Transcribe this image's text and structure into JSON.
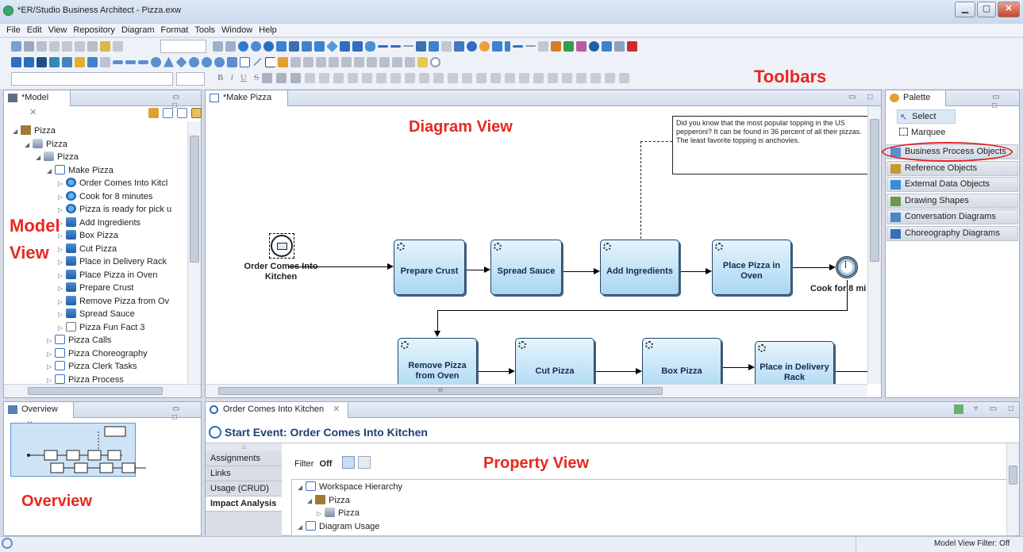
{
  "window": {
    "title": "*ER/Studio Business Architect - Pizza.exw",
    "buttons": {
      "minimize": "▁",
      "maximize": "▢",
      "close": "✕"
    }
  },
  "menu": [
    "File",
    "Edit",
    "View",
    "Repository",
    "Diagram",
    "Format",
    "Tools",
    "Window",
    "Help"
  ],
  "callouts": {
    "toolbars": "Toolbars",
    "diagram_view": "Diagram View",
    "model_view_1": "Model",
    "model_view_2": "View",
    "overview": "Overview",
    "property_view": "Property View"
  },
  "format_toolbar": {
    "bold": "B",
    "italic": "I",
    "underline": "U",
    "strike": "S"
  },
  "model_panel": {
    "tab": "*Model",
    "tree": [
      {
        "label": "Pizza",
        "icon": "folder-icon",
        "expanded": true
      },
      {
        "label": "Pizza",
        "icon": "model-icon",
        "expanded": true
      },
      {
        "label": "Pizza",
        "icon": "model-icon",
        "expanded": true
      },
      {
        "label": "Make Pizza",
        "icon": "process-icon",
        "expanded": true
      },
      {
        "label": "Order Comes Into Kitcl",
        "icon": "start-event-icon",
        "expanded": false
      },
      {
        "label": "Cook for 8 minutes",
        "icon": "event-icon",
        "expanded": false
      },
      {
        "label": "Pizza is ready for pick u",
        "icon": "event-icon",
        "expanded": false
      },
      {
        "label": "Add Ingredients",
        "icon": "task-icon",
        "expanded": false
      },
      {
        "label": "Box Pizza",
        "icon": "task-icon",
        "expanded": false
      },
      {
        "label": "Cut Pizza",
        "icon": "task-icon",
        "expanded": false
      },
      {
        "label": "Place in Delivery Rack",
        "icon": "task-icon",
        "expanded": false
      },
      {
        "label": "Place Pizza in Oven",
        "icon": "task-icon",
        "expanded": false
      },
      {
        "label": "Prepare Crust",
        "icon": "task-icon",
        "expanded": false
      },
      {
        "label": "Remove Pizza from Ov",
        "icon": "task-icon",
        "expanded": false
      },
      {
        "label": "Spread Sauce",
        "icon": "task-icon",
        "expanded": false
      },
      {
        "label": "Pizza Fun Fact 3",
        "icon": "fact-icon",
        "expanded": false
      },
      {
        "label": "Pizza Calls",
        "icon": "process-icon",
        "expanded": false
      },
      {
        "label": "Pizza Choreography",
        "icon": "process-icon",
        "expanded": false
      },
      {
        "label": "Pizza Clerk Tasks",
        "icon": "process-icon",
        "expanded": false
      },
      {
        "label": "Pizza Process",
        "icon": "process-icon",
        "expanded": false
      }
    ]
  },
  "diagram": {
    "tab": "*Make Pizza",
    "start_event": "Order Comes Into Kitchen",
    "note": "Did you know that the most popular topping in the US pepperoni? It can be found in 36 percent of all their pizzas.  The least favorite topping is anchovies.",
    "tasks_row1": [
      "Prepare Crust",
      "Spread Sauce",
      "Add Ingredients",
      "Place Pizza in Oven"
    ],
    "timer_label": "Cook for 8 mi",
    "tasks_row2": [
      "Remove Pizza from Oven",
      "Cut Pizza",
      "Box Pizza",
      "Place in Delivery Rack"
    ],
    "hscroll_grip": "III"
  },
  "palette": {
    "tab": "Palette",
    "tools": [
      "Select",
      "Marquee"
    ],
    "drawers": [
      {
        "label": "Business Process Objects",
        "color": "#5a8fd0",
        "highlighted": true
      },
      {
        "label": "Reference Objects",
        "color": "#c69a2b"
      },
      {
        "label": "External Data Objects",
        "color": "#3a8ed6"
      },
      {
        "label": "Drawing Shapes",
        "color": "#6a9a4a"
      },
      {
        "label": "Conversation Diagrams",
        "color": "#4a86c8"
      },
      {
        "label": "Choreography  Diagrams",
        "color": "#3a6fb5"
      }
    ],
    "highlight_color": "#e02020"
  },
  "overview_panel": {
    "tab": "Overview"
  },
  "property_panel": {
    "tab": "Order Comes Into Kitchen",
    "heading": "Start Event: Order Comes Into Kitchen",
    "side_tabs": [
      "Assignments",
      "Links",
      "Usage (CRUD)",
      "Impact Analysis"
    ],
    "active_side_tab": "Impact Analysis",
    "filter_label": "Filter",
    "filter_state": "Off",
    "tree": [
      {
        "label": "Workspace Hierarchy",
        "indent": 0
      },
      {
        "label": "Pizza",
        "indent": 1
      },
      {
        "label": "Pizza",
        "indent": 2
      },
      {
        "label": "Diagram Usage",
        "indent": 0
      }
    ]
  },
  "status": {
    "model_view_filter": "Model View Filter: Off"
  }
}
